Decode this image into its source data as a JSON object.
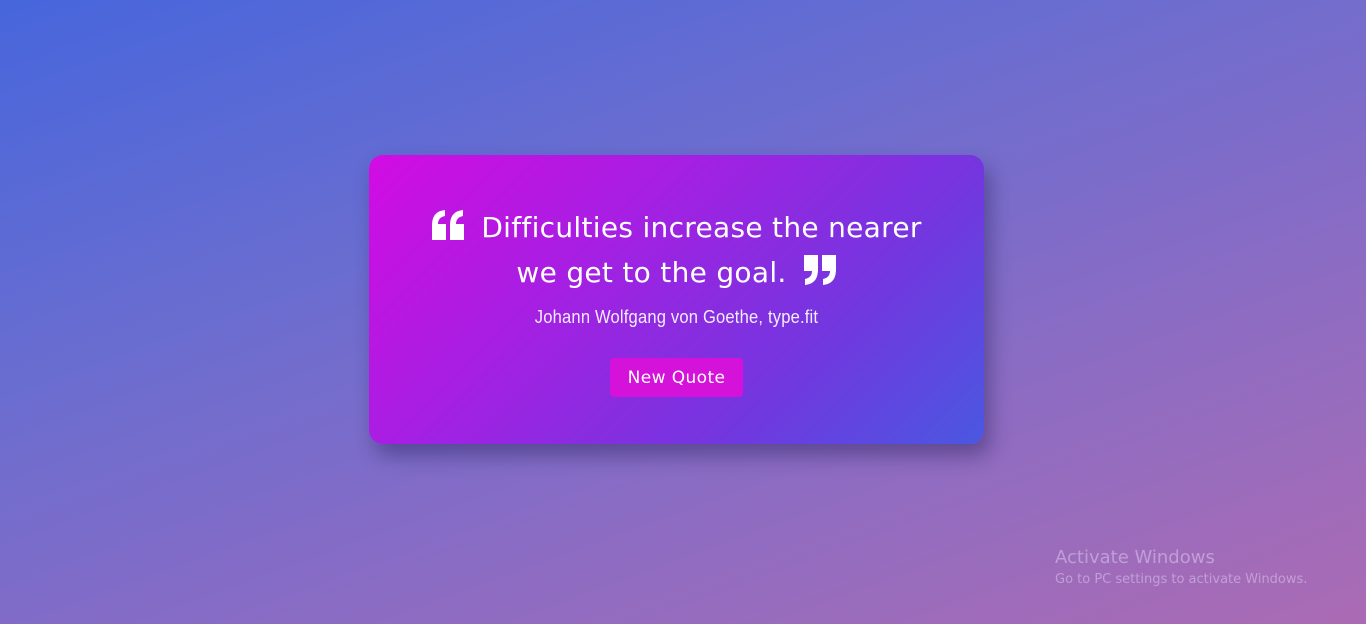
{
  "quote": {
    "line1": "Difficulties increase the nearer",
    "line2": "we get to the goal.",
    "author": "Johann Wolfgang von Goethe, type.fit",
    "open_icon": "quote-left-icon",
    "close_icon": "quote-right-icon"
  },
  "button": {
    "label": "New Quote"
  },
  "watermark": {
    "title": "Activate Windows",
    "subtitle": "Go to PC settings to activate Windows."
  },
  "colors": {
    "button": "#d412d9",
    "card_start": "#d20ce3",
    "card_end": "#4a58e0"
  }
}
